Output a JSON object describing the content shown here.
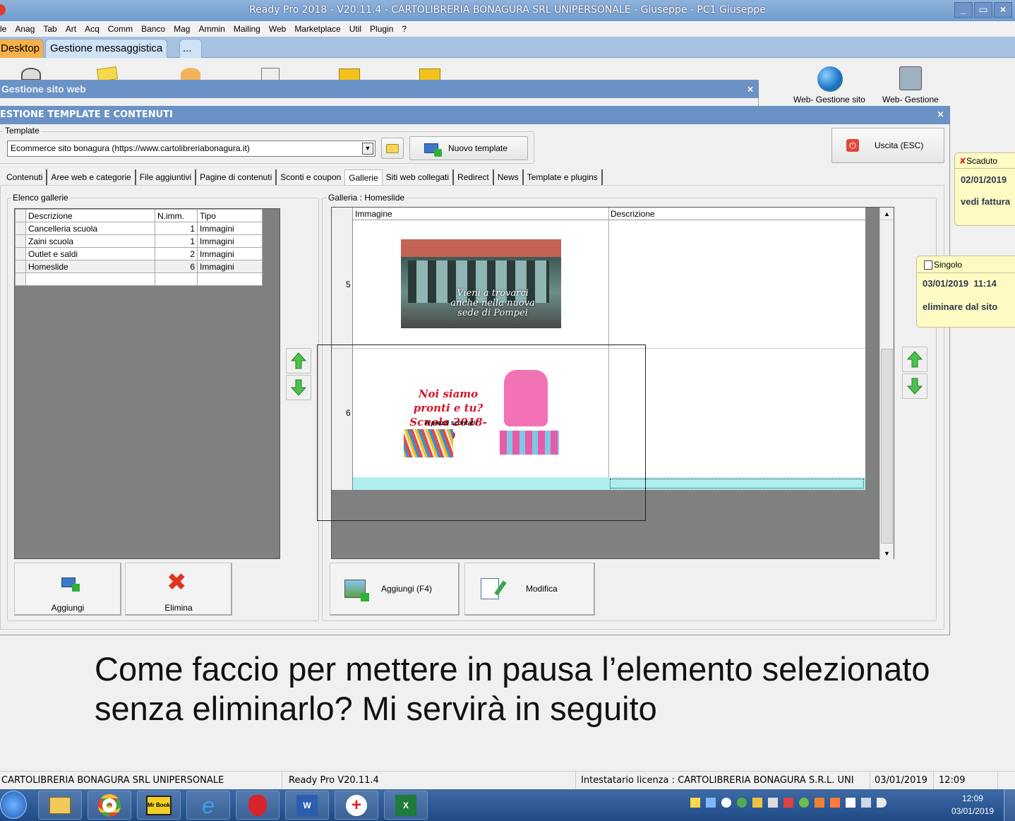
{
  "window": {
    "title": "Ready Pro 2018 - V20.11.4 - CARTOLIBRERIA BONAGURA SRL UNIPERSONALE - Giuseppe - PC1 Giuseppe"
  },
  "menu": [
    "le",
    "Anag",
    "Tab",
    "Art",
    "Acq",
    "Comm",
    "Banco",
    "Mag",
    "Ammin",
    "Mailing",
    "Web",
    "Marketplace",
    "Util",
    "Plugin",
    "?"
  ],
  "tabs": {
    "desktop": "Desktop",
    "messaggistica": "Gestione messaggistica",
    "more": "..."
  },
  "desktop_icons": {
    "web_gestione_sito": "Web- Gestione sito",
    "web_gestione": "Web- Gestione"
  },
  "gestione_sito": {
    "title": "Gestione sito web",
    "close": "×"
  },
  "template_win": {
    "title": "ESTIONE TEMPLATE E CONTENUTI",
    "close": "×",
    "template_label": "Template",
    "template_value": "Ecommerce sito bonagura (https://www.cartolibreriabonagura.it)",
    "new_template": "Nuovo template",
    "exit": "Uscita (ESC)"
  },
  "content_tabs": [
    "Contenuti",
    "Aree web e categorie",
    "File aggiuntivi",
    "Pagine di contenuti",
    "Sconti e coupon",
    "Gallerie",
    "Siti web collegati",
    "Redirect",
    "News",
    "Template e plugins"
  ],
  "gallery_list": {
    "label": "Elenco gallerie",
    "columns": [
      "Descrizione",
      "N.imm.",
      "Tipo"
    ],
    "rows": [
      {
        "name": "Cancelleria scuola",
        "count": "1",
        "type": "Immagini"
      },
      {
        "name": "Zaini scuola",
        "count": "1",
        "type": "Immagini"
      },
      {
        "name": "Outlet e saldi",
        "count": "2",
        "type": "Immagini"
      },
      {
        "name": "Homeslide",
        "count": "6",
        "type": "Immagini"
      }
    ],
    "add": "Aggiungi",
    "delete": "Elimina"
  },
  "gallery_detail": {
    "label": "Galleria : Homeslide",
    "columns": [
      "Immagine",
      "Descrizione"
    ],
    "rows": [
      {
        "num": "5",
        "img_text": "Vieni a trovarci anche nella nuova sede di Pompei"
      },
      {
        "num": "6",
        "img_text": "Noi siamo pronti e tu? Scuola 2018-19",
        "img_sub": "A prezzi scontati!"
      }
    ],
    "add": "Aggiungi (F4)",
    "edit": "Modifica"
  },
  "notes": [
    {
      "type": "Scaduto",
      "date": "02/01/2019",
      "text": "vedi fattura"
    },
    {
      "type": "Singolo",
      "date": "03/01/2019",
      "time": "11:14",
      "text": "eliminare dal sito"
    }
  ],
  "question": "Come faccio per mettere in pausa l’elemento selezionato senza eliminarlo? Mi servirà in seguito",
  "status": {
    "company": "CARTOLIBRERIA BONAGURA SRL UNIPERSONALE",
    "version": "Ready Pro V20.11.4",
    "license": "Intestatario licenza : CARTOLIBRERIA BONAGURA S.R.L. UNI",
    "date": "03/01/2019",
    "time": "12:09"
  },
  "clock": {
    "time": "12:09",
    "date": "03/01/2019"
  },
  "colors": {
    "titlebar": "#7aa3d4",
    "selected_row": "#aeeeee",
    "note": "#fdfac4",
    "taskbar": "#2a5594"
  }
}
